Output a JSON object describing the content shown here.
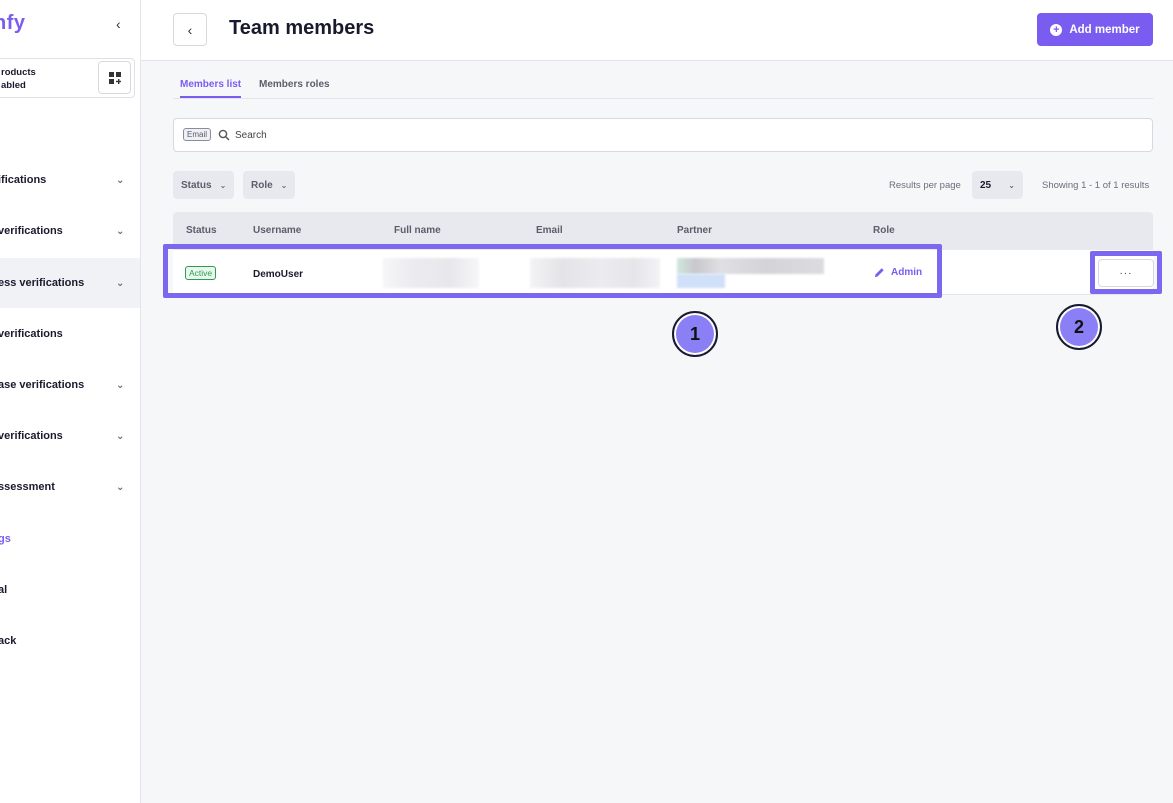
{
  "sidebar": {
    "logo": "nfy",
    "collapse_icon": "chevron-left-icon",
    "products_label": "roducts",
    "products_status": "abled",
    "grid_icon": "grid-add-icon",
    "items": [
      {
        "label": "ifications",
        "chevron": "⌄"
      },
      {
        "label": "verifications",
        "chevron": "⌄"
      },
      {
        "label": "ess verifications",
        "chevron": "⌄"
      },
      {
        "label": "verifications",
        "chevron": ""
      },
      {
        "label": "ase verifications",
        "chevron": "⌄"
      },
      {
        "label": "verifications",
        "chevron": "⌄"
      },
      {
        "label": "ssessment",
        "chevron": "⌄"
      },
      {
        "label": "gs",
        "chevron": ""
      },
      {
        "label": "al",
        "chevron": ""
      },
      {
        "label": "ack",
        "chevron": ""
      }
    ]
  },
  "header": {
    "title": "Team members",
    "add_button": "Add member",
    "back_icon": "chevron-left-icon"
  },
  "tabs": [
    {
      "label": "Members list",
      "active": true
    },
    {
      "label": "Members roles",
      "active": false
    }
  ],
  "search": {
    "chip": "Email",
    "placeholder": "Search"
  },
  "filters": {
    "status": "Status",
    "role": "Role",
    "results_per_page_label": "Results per page",
    "results_per_page": "25",
    "showing": "Showing 1 - 1 of 1 results"
  },
  "table": {
    "columns": [
      "Status",
      "Username",
      "Full name",
      "Email",
      "Partner",
      "Role"
    ],
    "rows": [
      {
        "status": "Active",
        "username": "DemoUser",
        "role": "Admin"
      }
    ],
    "more_label": "···"
  },
  "annotations": [
    {
      "label": "1"
    },
    {
      "label": "2"
    }
  ],
  "colors": {
    "accent": "#7b5cf0",
    "highlight": "#7b68f0",
    "active_green": "#2e9c4e"
  }
}
